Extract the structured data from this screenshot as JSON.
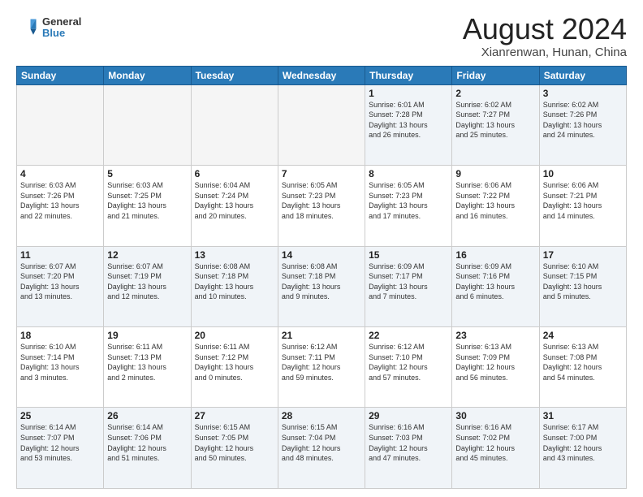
{
  "header": {
    "logo_general": "General",
    "logo_blue": "Blue",
    "month_title": "August 2024",
    "location": "Xianrenwan, Hunan, China"
  },
  "weekdays": [
    "Sunday",
    "Monday",
    "Tuesday",
    "Wednesday",
    "Thursday",
    "Friday",
    "Saturday"
  ],
  "weeks": [
    [
      {
        "day": "",
        "info": "",
        "empty": true
      },
      {
        "day": "",
        "info": "",
        "empty": true
      },
      {
        "day": "",
        "info": "",
        "empty": true
      },
      {
        "day": "",
        "info": "",
        "empty": true
      },
      {
        "day": "1",
        "info": "Sunrise: 6:01 AM\nSunset: 7:28 PM\nDaylight: 13 hours\nand 26 minutes."
      },
      {
        "day": "2",
        "info": "Sunrise: 6:02 AM\nSunset: 7:27 PM\nDaylight: 13 hours\nand 25 minutes."
      },
      {
        "day": "3",
        "info": "Sunrise: 6:02 AM\nSunset: 7:26 PM\nDaylight: 13 hours\nand 24 minutes."
      }
    ],
    [
      {
        "day": "4",
        "info": "Sunrise: 6:03 AM\nSunset: 7:26 PM\nDaylight: 13 hours\nand 22 minutes."
      },
      {
        "day": "5",
        "info": "Sunrise: 6:03 AM\nSunset: 7:25 PM\nDaylight: 13 hours\nand 21 minutes."
      },
      {
        "day": "6",
        "info": "Sunrise: 6:04 AM\nSunset: 7:24 PM\nDaylight: 13 hours\nand 20 minutes."
      },
      {
        "day": "7",
        "info": "Sunrise: 6:05 AM\nSunset: 7:23 PM\nDaylight: 13 hours\nand 18 minutes."
      },
      {
        "day": "8",
        "info": "Sunrise: 6:05 AM\nSunset: 7:23 PM\nDaylight: 13 hours\nand 17 minutes."
      },
      {
        "day": "9",
        "info": "Sunrise: 6:06 AM\nSunset: 7:22 PM\nDaylight: 13 hours\nand 16 minutes."
      },
      {
        "day": "10",
        "info": "Sunrise: 6:06 AM\nSunset: 7:21 PM\nDaylight: 13 hours\nand 14 minutes."
      }
    ],
    [
      {
        "day": "11",
        "info": "Sunrise: 6:07 AM\nSunset: 7:20 PM\nDaylight: 13 hours\nand 13 minutes."
      },
      {
        "day": "12",
        "info": "Sunrise: 6:07 AM\nSunset: 7:19 PM\nDaylight: 13 hours\nand 12 minutes."
      },
      {
        "day": "13",
        "info": "Sunrise: 6:08 AM\nSunset: 7:18 PM\nDaylight: 13 hours\nand 10 minutes."
      },
      {
        "day": "14",
        "info": "Sunrise: 6:08 AM\nSunset: 7:18 PM\nDaylight: 13 hours\nand 9 minutes."
      },
      {
        "day": "15",
        "info": "Sunrise: 6:09 AM\nSunset: 7:17 PM\nDaylight: 13 hours\nand 7 minutes."
      },
      {
        "day": "16",
        "info": "Sunrise: 6:09 AM\nSunset: 7:16 PM\nDaylight: 13 hours\nand 6 minutes."
      },
      {
        "day": "17",
        "info": "Sunrise: 6:10 AM\nSunset: 7:15 PM\nDaylight: 13 hours\nand 5 minutes."
      }
    ],
    [
      {
        "day": "18",
        "info": "Sunrise: 6:10 AM\nSunset: 7:14 PM\nDaylight: 13 hours\nand 3 minutes."
      },
      {
        "day": "19",
        "info": "Sunrise: 6:11 AM\nSunset: 7:13 PM\nDaylight: 13 hours\nand 2 minutes."
      },
      {
        "day": "20",
        "info": "Sunrise: 6:11 AM\nSunset: 7:12 PM\nDaylight: 13 hours\nand 0 minutes."
      },
      {
        "day": "21",
        "info": "Sunrise: 6:12 AM\nSunset: 7:11 PM\nDaylight: 12 hours\nand 59 minutes."
      },
      {
        "day": "22",
        "info": "Sunrise: 6:12 AM\nSunset: 7:10 PM\nDaylight: 12 hours\nand 57 minutes."
      },
      {
        "day": "23",
        "info": "Sunrise: 6:13 AM\nSunset: 7:09 PM\nDaylight: 12 hours\nand 56 minutes."
      },
      {
        "day": "24",
        "info": "Sunrise: 6:13 AM\nSunset: 7:08 PM\nDaylight: 12 hours\nand 54 minutes."
      }
    ],
    [
      {
        "day": "25",
        "info": "Sunrise: 6:14 AM\nSunset: 7:07 PM\nDaylight: 12 hours\nand 53 minutes."
      },
      {
        "day": "26",
        "info": "Sunrise: 6:14 AM\nSunset: 7:06 PM\nDaylight: 12 hours\nand 51 minutes."
      },
      {
        "day": "27",
        "info": "Sunrise: 6:15 AM\nSunset: 7:05 PM\nDaylight: 12 hours\nand 50 minutes."
      },
      {
        "day": "28",
        "info": "Sunrise: 6:15 AM\nSunset: 7:04 PM\nDaylight: 12 hours\nand 48 minutes."
      },
      {
        "day": "29",
        "info": "Sunrise: 6:16 AM\nSunset: 7:03 PM\nDaylight: 12 hours\nand 47 minutes."
      },
      {
        "day": "30",
        "info": "Sunrise: 6:16 AM\nSunset: 7:02 PM\nDaylight: 12 hours\nand 45 minutes."
      },
      {
        "day": "31",
        "info": "Sunrise: 6:17 AM\nSunset: 7:00 PM\nDaylight: 12 hours\nand 43 minutes."
      }
    ]
  ]
}
